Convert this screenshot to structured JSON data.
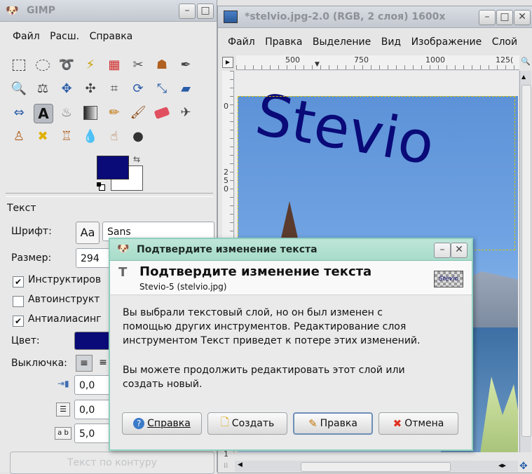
{
  "toolbox": {
    "title": "GIMP",
    "menu": [
      "Файл",
      "Расш.",
      "Справка"
    ],
    "fg_color": "#0a0a78",
    "bg_color": "#ffffff",
    "section_title": "Текст",
    "font_label": "Шрифт:",
    "font_preview": "Aa",
    "font_value": "Sans",
    "size_label": "Размер:",
    "size_value": "294",
    "hinting_label": "Инструктиров",
    "autohinting_label": "Автоинструкт",
    "antialias_label": "Антиалиасинг",
    "color_label": "Цвет:",
    "justify_label": "Выключка:",
    "indent_value": "0,0",
    "line_spacing_value": "0,0",
    "letter_spacing_value": "5,0",
    "path_button": "Текст по контуру"
  },
  "image_window": {
    "title": "*stelvio.jpg-2.0 (RGB, 2 слоя) 1600x",
    "menu": [
      "Файл",
      "Правка",
      "Выделение",
      "Вид",
      "Изображение",
      "Слой"
    ],
    "ruler_top": [
      "500",
      "750",
      "1000",
      "125("
    ],
    "ruler_left": [
      "0",
      "2",
      "5",
      "0"
    ],
    "ruler_bottom": "1",
    "canvas_text": "Stevio",
    "text_color": "#0a0a78"
  },
  "dialog": {
    "title": "Подтвердите изменение текста",
    "heading": "Подтвердите изменение текста",
    "subtitle": "Stevio-5 (stelvio.jpg)",
    "thumb_text": "Stevio",
    "message1_line1": "Вы выбрали текстовый слой, но он был изменен с",
    "message1_line2": "помощью других инструментов. Редактирование слоя",
    "message1_line3": "инструментом Текст приведет к потере этих изменений.",
    "message2_line1": "Вы можете продолжить редактировать этот слой или",
    "message2_line2": "создать новый.",
    "buttons": {
      "help": "Справка",
      "create": "Создать",
      "edit": "Правка",
      "cancel": "Отмена"
    }
  }
}
